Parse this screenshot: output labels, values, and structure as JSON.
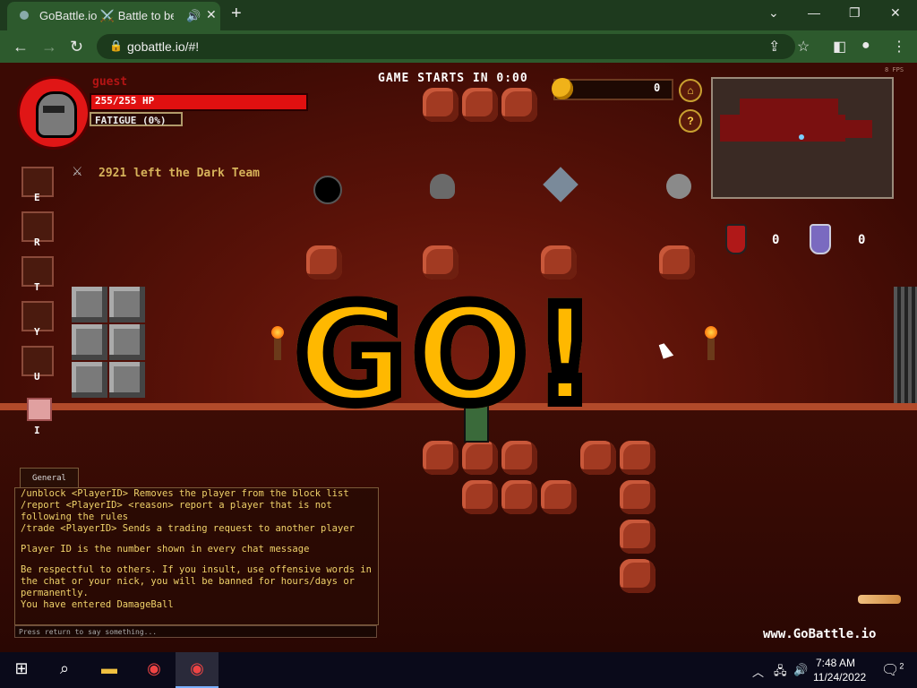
{
  "browser": {
    "tab_title": "GoBattle.io ⚔️ Battle to be t",
    "new_tab": "+",
    "url": "gobattle.io/#!",
    "window_controls": [
      "⌄",
      "—",
      "❐",
      "✕"
    ]
  },
  "hud": {
    "username": "guest",
    "hp": "255/255 HP",
    "fatigue": "FATIGUE (0%)",
    "hotkeys": [
      "E",
      "R",
      "T",
      "Y",
      "U",
      "I"
    ],
    "killfeed": "2921 left the Dark Team",
    "countdown": "GAME STARTS IN 0:00",
    "gold": "0",
    "home_icon": "⌂",
    "help_icon": "?",
    "fps": "8 FPS",
    "team_red_score": "0",
    "team_blue_score": "0",
    "go_text": "GO!"
  },
  "chat": {
    "tab": "General",
    "lines": [
      "/unblock <PlayerID> Removes the player from the block list",
      "/report <PlayerID> <reason> report a player that is not following the rules",
      "/trade <PlayerID> Sends a trading request to another player",
      "",
      "Player ID is the number shown in every chat message",
      "",
      "Be respectful to others. If you insult, use offensive words in the chat or your nick, you will be banned for hours/days or permanently.",
      "You have entered DamageBall"
    ],
    "input_placeholder": "Press return to say something..."
  },
  "branding": "www.GoBattle.io",
  "taskbar": {
    "time": "7:48 AM",
    "date": "11/24/2022",
    "notifications": "2"
  }
}
